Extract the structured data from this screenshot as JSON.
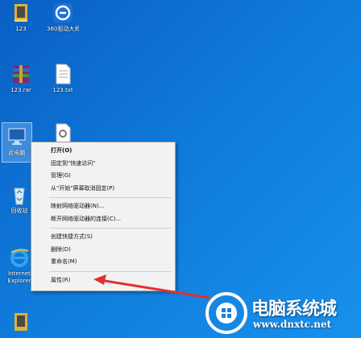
{
  "desktop": {
    "icons": [
      {
        "name": "folder-123-icon",
        "label": "123"
      },
      {
        "name": "app-360-icon",
        "label": "360驱动大师"
      },
      {
        "name": "archive-rar-icon",
        "label": "123.rar"
      },
      {
        "name": "text-file-icon",
        "label": "123.txt"
      },
      {
        "name": "computer-icon",
        "label": "此电脑"
      },
      {
        "name": "settings-file-icon",
        "label": ""
      },
      {
        "name": "recycle-bin-icon",
        "label": "回收站"
      },
      {
        "name": "ie-icon",
        "label": "Internet Explorer"
      }
    ]
  },
  "context_menu": {
    "items": [
      {
        "label": "打开(O)",
        "bold": true
      },
      {
        "label": "固定到\"快速访问\""
      },
      {
        "label": "管理(G)"
      },
      {
        "label": "从\"开始\"屏幕取消固定(P)"
      },
      {
        "separator": true
      },
      {
        "label": "映射网络驱动器(N)..."
      },
      {
        "label": "断开网络驱动器的连接(C)..."
      },
      {
        "separator": true
      },
      {
        "label": "创建快捷方式(S)"
      },
      {
        "label": "删除(D)"
      },
      {
        "label": "重命名(M)"
      },
      {
        "separator": true
      },
      {
        "label": "属性(R)"
      }
    ]
  },
  "watermark": {
    "title": "电脑系统城",
    "url": "www.dnxtc.net"
  },
  "colors": {
    "desktop": "#0f79da",
    "arrow": "#e03030"
  }
}
